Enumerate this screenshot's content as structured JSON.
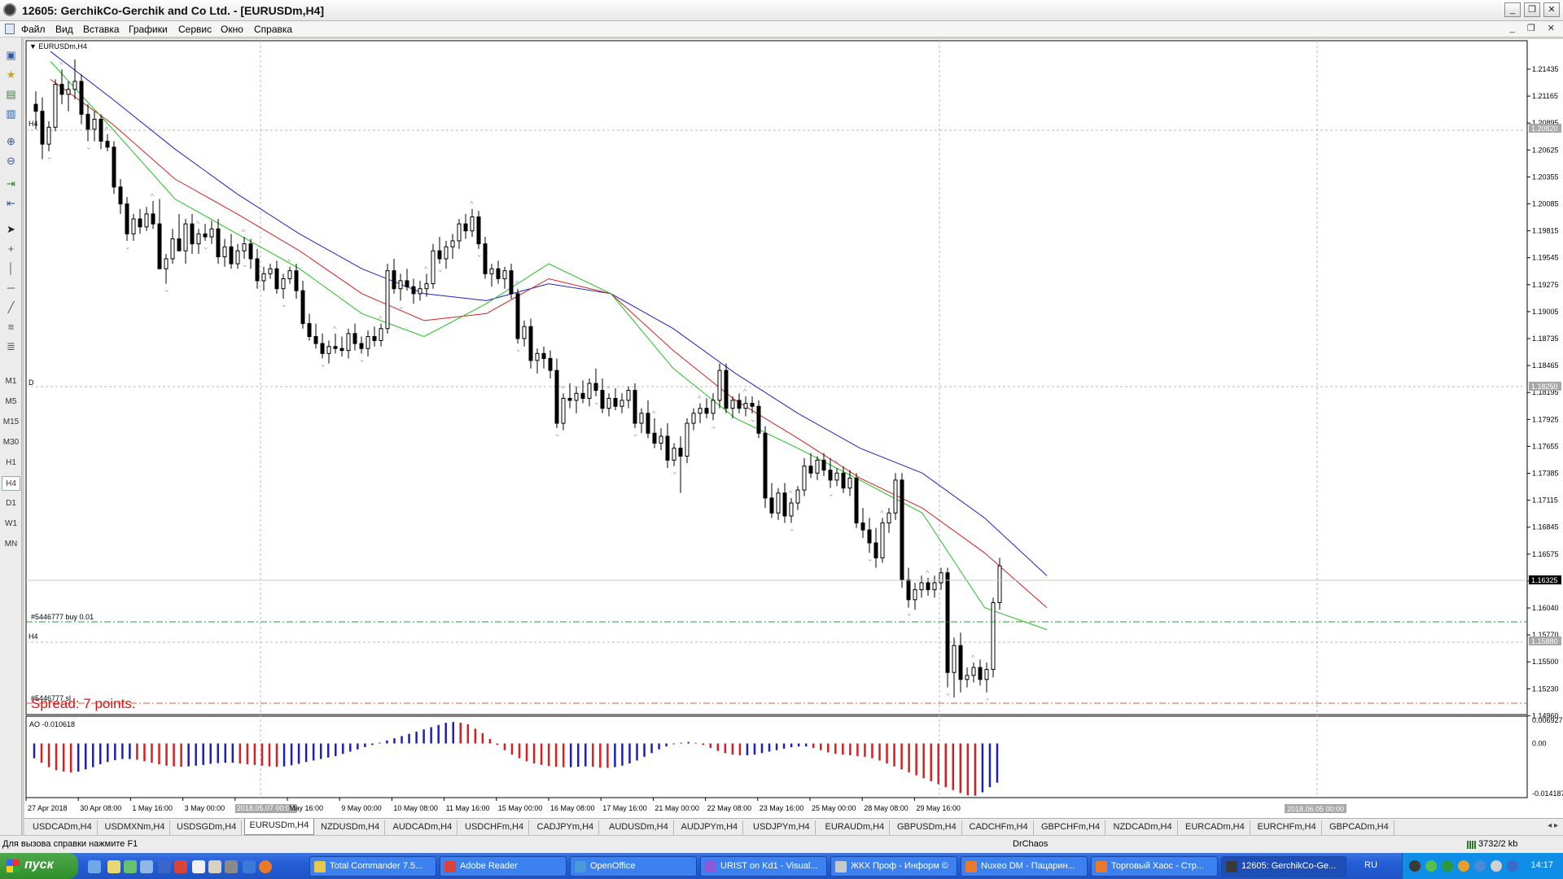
{
  "window": {
    "title": "12605: GerchikCo-Gerchik and Co Ltd. - [EURUSDm,H4]"
  },
  "menu": [
    "Файл",
    "Вид",
    "Вставка",
    "Графики",
    "Сервис",
    "Окно",
    "Справка"
  ],
  "timeframes": [
    "M1",
    "M5",
    "M15",
    "M30",
    "H1",
    "H4",
    "D1",
    "W1",
    "MN"
  ],
  "active_timeframe": "H4",
  "toolbar_icons": [
    "new-chart-icon",
    "favorites-icon",
    "profiles-icon",
    "navigator-icon",
    "zoom-in-icon",
    "zoom-out-icon",
    "chart-shift-icon",
    "autoscroll-icon",
    "cursor-icon",
    "crosshair-icon",
    "vertical-line-icon",
    "horizontal-line-icon",
    "trend-line-icon",
    "channel-icon",
    "fibonacci-icon"
  ],
  "chart": {
    "symbol_label": "EURUSDm,H4",
    "h4_label_1": "H4",
    "d_label": "D",
    "order_label": "#5446777 buy 0.01",
    "h4_label_2": "H4",
    "sl_label": "#5446777 sl",
    "spread_text": "Spread: 7 points.",
    "price_ticks": [
      "1.21435",
      "1.21165",
      "1.20895",
      "1.20625",
      "1.20355",
      "1.20085",
      "1.19815",
      "1.19545",
      "1.19275",
      "1.19005",
      "1.18735",
      "1.18465",
      "1.18195",
      "1.17925",
      "1.17655",
      "1.17385",
      "1.17115",
      "1.16845",
      "1.16575",
      "1.16305",
      "1.16040",
      "1.15770",
      "1.15500",
      "1.15230",
      "1.14960"
    ],
    "price_markers": {
      "upper": "1.20820",
      "middle": "1.18250",
      "current": "1.16325",
      "entry": "1.15880"
    },
    "time_ticks": [
      "27 Apr 2018",
      "30 Apr 08:00",
      "1 May 16:00",
      "3 May 00:00",
      "2018.05.07 00:00",
      "May 16:00",
      "9 May 00:00",
      "10 May 08:00",
      "11 May 16:00",
      "15 May 00:00",
      "16 May 08:00",
      "17 May 16:00",
      "21 May 00:00",
      "22 May 08:00",
      "23 May 16:00",
      "25 May 00:00",
      "28 May 08:00",
      "29 May 16:00"
    ],
    "time_highlight_right": "2018.06.05 00:00",
    "ao_label": "AO -0.010618",
    "ao_ticks": [
      "0.006927",
      "0.00",
      "-0.014187"
    ]
  },
  "chart_data": {
    "type": "candlestick",
    "symbol": "EURUSDm",
    "timeframe": "H4",
    "ylim": [
      1.1496,
      1.2159
    ],
    "candles": [
      [
        1.2105,
        1.2118,
        1.208,
        1.2098
      ],
      [
        1.2098,
        1.2112,
        1.205,
        1.2065
      ],
      [
        1.2065,
        1.2088,
        1.2058,
        1.2082
      ],
      [
        1.2082,
        1.213,
        1.2078,
        1.2125
      ],
      [
        1.2125,
        1.214,
        1.2105,
        1.2115
      ],
      [
        1.2115,
        1.2128,
        1.2098,
        1.212
      ],
      [
        1.212,
        1.215,
        1.211,
        1.2128
      ],
      [
        1.2128,
        1.2135,
        1.2085,
        1.2095
      ],
      [
        1.2095,
        1.2105,
        1.2068,
        1.208
      ],
      [
        1.208,
        1.2098,
        1.2068,
        1.209
      ],
      [
        1.209,
        1.2095,
        1.206,
        1.2068
      ],
      [
        1.2068,
        1.2075,
        1.2058,
        1.2062
      ],
      [
        1.2062,
        1.2068,
        1.2015,
        1.2022
      ],
      [
        1.2022,
        1.203,
        1.1995,
        1.2005
      ],
      [
        1.2005,
        1.2012,
        1.1968,
        1.1975
      ],
      [
        1.1975,
        1.1995,
        1.1968,
        1.199
      ],
      [
        1.199,
        1.2,
        1.1975,
        1.1982
      ],
      [
        1.1982,
        1.2002,
        1.1978,
        1.1995
      ],
      [
        1.1995,
        1.2008,
        1.198,
        1.1985
      ],
      [
        1.1985,
        1.201,
        1.1975,
        1.194
      ],
      [
        1.194,
        1.1955,
        1.1925,
        1.195
      ],
      [
        1.195,
        1.198,
        1.1945,
        1.197
      ],
      [
        1.197,
        1.1995,
        1.1962,
        1.1958
      ],
      [
        1.1958,
        1.199,
        1.1945,
        1.1985
      ],
      [
        1.1985,
        1.1995,
        1.1955,
        1.1965
      ],
      [
        1.1965,
        1.198,
        1.1955,
        1.1975
      ],
      [
        1.1975,
        1.1985,
        1.1968,
        1.1972
      ],
      [
        1.1972,
        1.1988,
        1.1965,
        1.198
      ],
      [
        1.198,
        1.199,
        1.1945,
        1.1952
      ],
      [
        1.1952,
        1.197,
        1.1942,
        1.1962
      ],
      [
        1.1962,
        1.1975,
        1.194,
        1.1945
      ],
      [
        1.1945,
        1.1965,
        1.194,
        1.1958
      ],
      [
        1.1958,
        1.1972,
        1.195,
        1.1965
      ],
      [
        1.1965,
        1.197,
        1.194,
        1.195
      ],
      [
        1.195,
        1.196,
        1.192,
        1.1928
      ],
      [
        1.1928,
        1.1942,
        1.1918,
        1.1935
      ],
      [
        1.1935,
        1.1945,
        1.193,
        1.194
      ],
      [
        1.194,
        1.1948,
        1.1915,
        1.192
      ],
      [
        1.192,
        1.1935,
        1.191,
        1.193
      ],
      [
        1.193,
        1.1942,
        1.1925,
        1.1938
      ],
      [
        1.1938,
        1.1945,
        1.191,
        1.1918
      ],
      [
        1.1918,
        1.1928,
        1.188,
        1.1885
      ],
      [
        1.1885,
        1.1895,
        1.1868,
        1.1872
      ],
      [
        1.1872,
        1.1885,
        1.186,
        1.1865
      ],
      [
        1.1865,
        1.1875,
        1.185,
        1.1855
      ],
      [
        1.1855,
        1.1868,
        1.1845,
        1.1862
      ],
      [
        1.1862,
        1.1875,
        1.1855,
        1.186
      ],
      [
        1.186,
        1.1872,
        1.1852,
        1.1858
      ],
      [
        1.1858,
        1.188,
        1.185,
        1.1875
      ],
      [
        1.1875,
        1.1885,
        1.1858,
        1.1865
      ],
      [
        1.1865,
        1.1872,
        1.1855,
        1.186
      ],
      [
        1.186,
        1.1878,
        1.1852,
        1.1872
      ],
      [
        1.1872,
        1.1882,
        1.1862,
        1.1868
      ],
      [
        1.1868,
        1.1885,
        1.1862,
        1.188
      ],
      [
        1.188,
        1.1945,
        1.1875,
        1.1938
      ],
      [
        1.1938,
        1.195,
        1.1915,
        1.192
      ],
      [
        1.192,
        1.1935,
        1.1908,
        1.1928
      ],
      [
        1.1928,
        1.194,
        1.1918,
        1.1922
      ],
      [
        1.1922,
        1.193,
        1.1905,
        1.1915
      ],
      [
        1.1915,
        1.1928,
        1.1908,
        1.192
      ],
      [
        1.192,
        1.1935,
        1.1912,
        1.1925
      ],
      [
        1.1925,
        1.1965,
        1.192,
        1.1958
      ],
      [
        1.1958,
        1.1972,
        1.1945,
        1.195
      ],
      [
        1.195,
        1.1968,
        1.194,
        1.1962
      ],
      [
        1.1962,
        1.1975,
        1.195,
        1.1968
      ],
      [
        1.1968,
        1.199,
        1.196,
        1.1985
      ],
      [
        1.1985,
        1.1995,
        1.197,
        1.1978
      ],
      [
        1.1978,
        1.2,
        1.1972,
        1.1992
      ],
      [
        1.1992,
        1.1998,
        1.196,
        1.1965
      ],
      [
        1.1965,
        1.1972,
        1.193,
        1.1935
      ],
      [
        1.1935,
        1.1945,
        1.1922,
        1.194
      ],
      [
        1.194,
        1.1948,
        1.1925,
        1.193
      ],
      [
        1.193,
        1.1942,
        1.192,
        1.1938
      ],
      [
        1.1938,
        1.1945,
        1.191,
        1.1915
      ],
      [
        1.1915,
        1.192,
        1.1865,
        1.187
      ],
      [
        1.187,
        1.1888,
        1.1862,
        1.1882
      ],
      [
        1.1882,
        1.189,
        1.184,
        1.1848
      ],
      [
        1.1848,
        1.186,
        1.1835,
        1.1855
      ],
      [
        1.1855,
        1.1862,
        1.184,
        1.185
      ],
      [
        1.185,
        1.1858,
        1.183,
        1.1838
      ],
      [
        1.1838,
        1.185,
        1.178,
        1.1785
      ],
      [
        1.1785,
        1.1815,
        1.1778,
        1.181
      ],
      [
        1.181,
        1.1825,
        1.18,
        1.1808
      ],
      [
        1.1808,
        1.1822,
        1.1795,
        1.1815
      ],
      [
        1.1815,
        1.1828,
        1.1805,
        1.181
      ],
      [
        1.181,
        1.183,
        1.1802,
        1.1825
      ],
      [
        1.1825,
        1.184,
        1.1812,
        1.1818
      ],
      [
        1.1818,
        1.183,
        1.1795,
        1.18
      ],
      [
        1.18,
        1.1815,
        1.1792,
        1.181
      ],
      [
        1.181,
        1.182,
        1.1798,
        1.1802
      ],
      [
        1.1802,
        1.1815,
        1.1795,
        1.1808
      ],
      [
        1.1808,
        1.1822,
        1.18,
        1.1818
      ],
      [
        1.1818,
        1.1825,
        1.178,
        1.1785
      ],
      [
        1.1785,
        1.18,
        1.1775,
        1.1795
      ],
      [
        1.1795,
        1.1808,
        1.177,
        1.1775
      ],
      [
        1.1775,
        1.179,
        1.176,
        1.1765
      ],
      [
        1.1765,
        1.178,
        1.1758,
        1.1772
      ],
      [
        1.1772,
        1.1785,
        1.174,
        1.1748
      ],
      [
        1.1748,
        1.1765,
        1.1742,
        1.176
      ],
      [
        1.176,
        1.1772,
        1.1715,
        1.1752
      ],
      [
        1.1752,
        1.179,
        1.1745,
        1.1785
      ],
      [
        1.1785,
        1.18,
        1.1778,
        1.1795
      ],
      [
        1.1795,
        1.1805,
        1.1785,
        1.18
      ],
      [
        1.18,
        1.181,
        1.179,
        1.1795
      ],
      [
        1.1795,
        1.1815,
        1.1788,
        1.1808
      ],
      [
        1.1808,
        1.1845,
        1.18,
        1.1838
      ],
      [
        1.1838,
        1.1845,
        1.1795,
        1.18
      ],
      [
        1.18,
        1.1812,
        1.179,
        1.1808
      ],
      [
        1.1808,
        1.1815,
        1.1795,
        1.18
      ],
      [
        1.18,
        1.1812,
        1.1792,
        1.1805
      ],
      [
        1.1805,
        1.1812,
        1.1795,
        1.1802
      ],
      [
        1.1802,
        1.1808,
        1.177,
        1.1775
      ],
      [
        1.1775,
        1.1782,
        1.17,
        1.171
      ],
      [
        1.171,
        1.1725,
        1.169,
        1.1695
      ],
      [
        1.1695,
        1.172,
        1.1688,
        1.1715
      ],
      [
        1.1715,
        1.1725,
        1.1685,
        1.1692
      ],
      [
        1.1692,
        1.171,
        1.1685,
        1.1705
      ],
      [
        1.1705,
        1.1722,
        1.1698,
        1.1718
      ],
      [
        1.1718,
        1.175,
        1.1712,
        1.1742
      ],
      [
        1.1742,
        1.1755,
        1.173,
        1.1735
      ],
      [
        1.1735,
        1.1752,
        1.1728,
        1.1748
      ],
      [
        1.1748,
        1.1755,
        1.1732,
        1.1738
      ],
      [
        1.1738,
        1.175,
        1.172,
        1.1728
      ],
      [
        1.1728,
        1.174,
        1.1722,
        1.1735
      ],
      [
        1.1735,
        1.1742,
        1.1715,
        1.172
      ],
      [
        1.172,
        1.1738,
        1.1712,
        1.173
      ],
      [
        1.173,
        1.1735,
        1.168,
        1.1685
      ],
      [
        1.1685,
        1.17,
        1.167,
        1.1678
      ],
      [
        1.1678,
        1.169,
        1.1655,
        1.1665
      ],
      [
        1.1665,
        1.168,
        1.164,
        1.165
      ],
      [
        1.165,
        1.169,
        1.1645,
        1.1685
      ],
      [
        1.1685,
        1.17,
        1.1675,
        1.1695
      ],
      [
        1.1695,
        1.1735,
        1.1688,
        1.1728
      ],
      [
        1.1728,
        1.1735,
        1.162,
        1.1628
      ],
      [
        1.1628,
        1.164,
        1.16,
        1.1608
      ],
      [
        1.1608,
        1.1625,
        1.1598,
        1.1618
      ],
      [
        1.1618,
        1.1632,
        1.161,
        1.1625
      ],
      [
        1.1625,
        1.163,
        1.1612,
        1.1618
      ],
      [
        1.1618,
        1.1632,
        1.161,
        1.1625
      ],
      [
        1.1625,
        1.164,
        1.1618,
        1.1635
      ],
      [
        1.1635,
        1.164,
        1.152,
        1.1535
      ],
      [
        1.1535,
        1.157,
        1.151,
        1.1562
      ],
      [
        1.1562,
        1.1575,
        1.1515,
        1.1528
      ],
      [
        1.1528,
        1.154,
        1.152,
        1.1532
      ],
      [
        1.1532,
        1.1545,
        1.1525,
        1.154
      ],
      [
        1.154,
        1.1548,
        1.1522,
        1.1528
      ],
      [
        1.1528,
        1.1545,
        1.1515,
        1.1538
      ],
      [
        1.1538,
        1.161,
        1.153,
        1.1605
      ],
      [
        1.1605,
        1.165,
        1.1598,
        1.1642
      ]
    ],
    "ma_blue": [
      1.2158,
      1.211,
      1.206,
      1.2015,
      1.1975,
      1.194,
      1.1915,
      1.1908,
      1.1925,
      1.1915,
      1.188,
      1.1835,
      1.1795,
      1.176,
      1.1735,
      1.169,
      1.1632
    ],
    "ma_red": [
      1.213,
      1.2085,
      1.203,
      1.1995,
      1.1958,
      1.1915,
      1.1888,
      1.1895,
      1.193,
      1.1915,
      1.1858,
      1.1808,
      1.177,
      1.173,
      1.17,
      1.1655,
      1.16
    ],
    "ma_green": [
      1.2148,
      1.208,
      1.201,
      1.1975,
      1.194,
      1.1895,
      1.1872,
      1.1905,
      1.1945,
      1.1915,
      1.184,
      1.179,
      1.176,
      1.1728,
      1.1695,
      1.16,
      1.1578
    ],
    "ao_values": [
      -0.004,
      -0.0052,
      -0.0064,
      -0.0072,
      -0.0076,
      -0.0078,
      -0.0076,
      -0.007,
      -0.0064,
      -0.0056,
      -0.005,
      -0.0045,
      -0.0042,
      -0.0042,
      -0.0044,
      -0.0048,
      -0.0052,
      -0.0056,
      -0.006,
      -0.0062,
      -0.0063,
      -0.0062,
      -0.006,
      -0.0058,
      -0.0055,
      -0.0053,
      -0.0052,
      -0.0052,
      -0.0054,
      -0.0056,
      -0.0058,
      -0.006,
      -0.0062,
      -0.0063,
      -0.0062,
      -0.0059,
      -0.0055,
      -0.005,
      -0.0046,
      -0.0042,
      -0.0038,
      -0.0034,
      -0.0028,
      -0.0022,
      -0.0016,
      -0.001,
      -0.0004,
      0.0002,
      0.0008,
      0.0014,
      0.002,
      0.0026,
      0.0032,
      0.0038,
      0.0044,
      0.005,
      0.0056,
      0.0058,
      0.0056,
      0.0052,
      0.004,
      0.0028,
      0.0012,
      -0.0004,
      -0.0018,
      -0.003,
      -0.004,
      -0.0048,
      -0.0054,
      -0.0058,
      -0.0061,
      -0.0063,
      -0.0064,
      -0.0064,
      -0.0063,
      -0.0062,
      -0.0063,
      -0.0065,
      -0.0066,
      -0.0064,
      -0.006,
      -0.0054,
      -0.0046,
      -0.0036,
      -0.0026,
      -0.0016,
      -0.0008,
      -0.0002,
      0.0002,
      0.0004,
      0.0002,
      -0.0004,
      -0.0012,
      -0.002,
      -0.0026,
      -0.003,
      -0.0032,
      -0.0032,
      -0.003,
      -0.0026,
      -0.0022,
      -0.0018,
      -0.0014,
      -0.001,
      -0.0008,
      -0.0008,
      -0.0012,
      -0.0018,
      -0.0024,
      -0.0028,
      -0.003,
      -0.0032,
      -0.0034,
      -0.0036,
      -0.004,
      -0.0046,
      -0.0054,
      -0.0062,
      -0.007,
      -0.0078,
      -0.0086,
      -0.0094,
      -0.0102,
      -0.011,
      -0.0118,
      -0.0126,
      -0.0134,
      -0.014,
      -0.0141,
      -0.0132,
      -0.0118,
      -0.0106
    ]
  },
  "symbol_tabs": [
    "USDCADm,H4",
    "USDMXNm,H4",
    "USDSGDm,H4",
    "EURUSDm,H4",
    "NZDUSDm,H4",
    "AUDCADm,H4",
    "USDCHFm,H4",
    "CADJPYm,H4",
    "AUDUSDm,H4",
    "AUDJPYm,H4",
    "USDJPYm,H4",
    "EURAUDm,H4",
    "GBPUSDm,H4",
    "CADCHFm,H4",
    "GBPCHFm,H4",
    "NZDCADm,H4",
    "EURCADm,H4",
    "EURCHFm,H4",
    "GBPCADm,H4"
  ],
  "active_tab": "EURUSDm,H4",
  "status": {
    "help": "Для вызова справки нажмите F1",
    "profile": "DrChaos",
    "bytes": "3732/2 kb"
  },
  "taskbar": {
    "start_label": "пуск",
    "buttons": [
      "Total Commander 7.5...",
      "Adobe Reader",
      "OpenOffice",
      "URIST on Kd1 - Visual...",
      "ЖКХ Проф - Информ ©",
      "Nuxeo DM - Пацарин...",
      "Торговый Хаос - Стр...",
      "12605: GerchikCo-Ge..."
    ],
    "lang": "RU",
    "clock": "14:17"
  }
}
